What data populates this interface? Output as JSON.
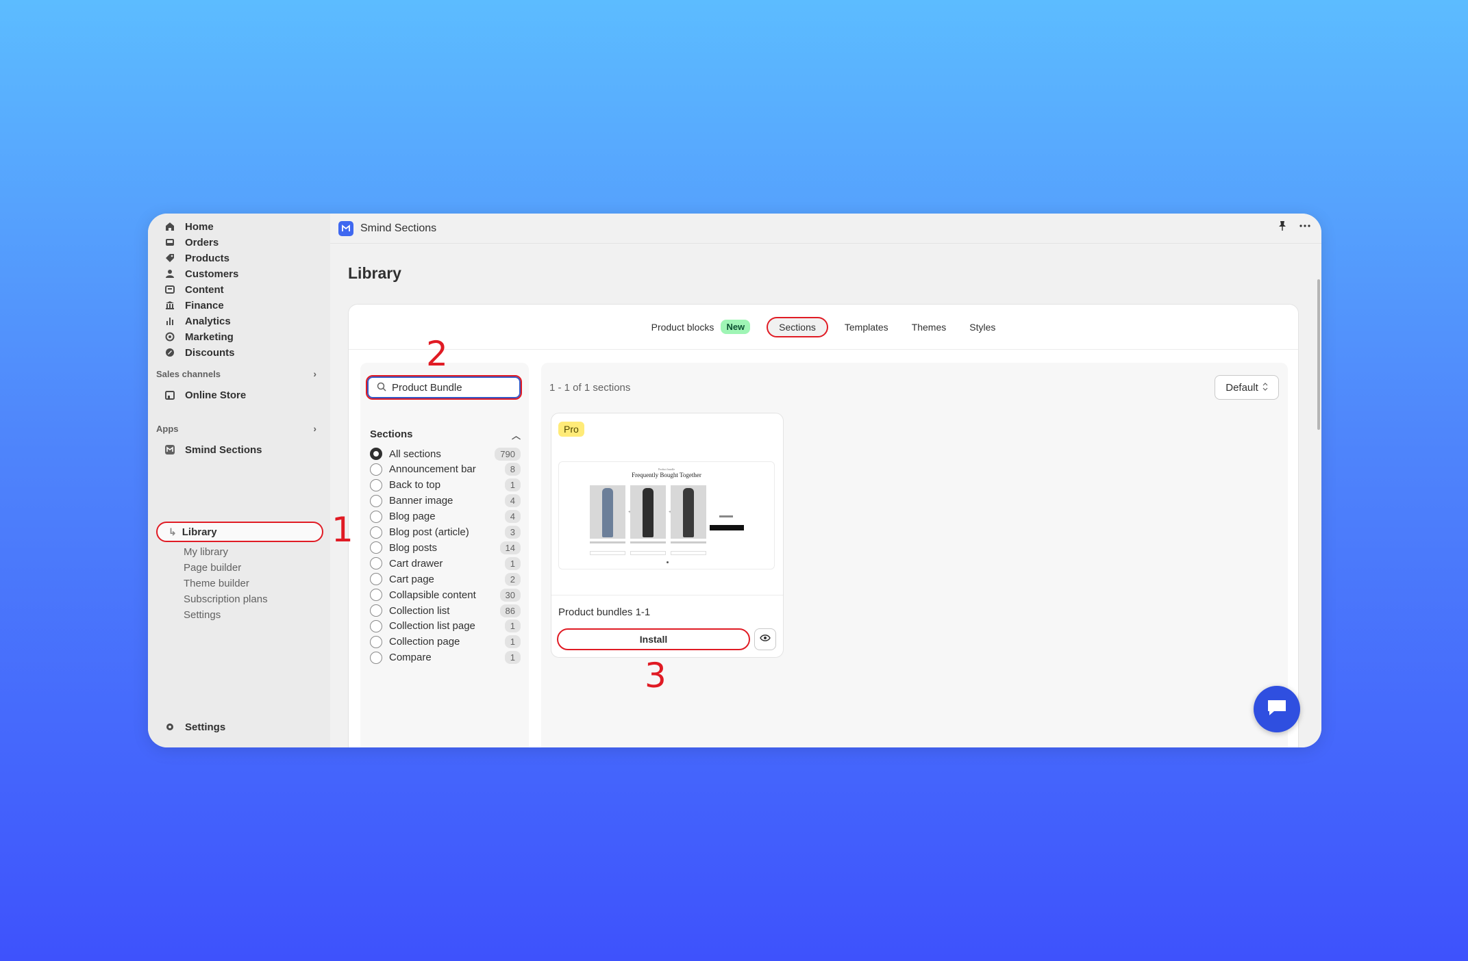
{
  "sidebar": {
    "nav": [
      {
        "label": "Home",
        "icon": "home-icon"
      },
      {
        "label": "Orders",
        "icon": "inbox-icon"
      },
      {
        "label": "Products",
        "icon": "tag-icon"
      },
      {
        "label": "Customers",
        "icon": "person-icon"
      },
      {
        "label": "Content",
        "icon": "content-icon"
      },
      {
        "label": "Finance",
        "icon": "bank-icon"
      },
      {
        "label": "Analytics",
        "icon": "bar-chart-icon"
      },
      {
        "label": "Marketing",
        "icon": "target-icon"
      },
      {
        "label": "Discounts",
        "icon": "discount-icon"
      }
    ],
    "sales_channels_label": "Sales channels",
    "online_store_label": "Online Store",
    "apps_label": "Apps",
    "app_name": "Smind Sections",
    "library_label": "Library",
    "sub_items": [
      "My library",
      "Page builder",
      "Theme builder",
      "Subscription plans",
      "Settings"
    ],
    "settings_label": "Settings"
  },
  "topbar": {
    "app_name": "Smind Sections"
  },
  "page": {
    "title": "Library"
  },
  "tabs": {
    "product_blocks": "Product blocks",
    "new_badge": "New",
    "sections": "Sections",
    "templates": "Templates",
    "themes": "Themes",
    "styles": "Styles"
  },
  "search": {
    "value": "Product Bundle"
  },
  "filters": {
    "heading": "Sections",
    "items": [
      {
        "label": "All sections",
        "count": "790",
        "selected": true
      },
      {
        "label": "Announcement bar",
        "count": "8"
      },
      {
        "label": "Back to top",
        "count": "1"
      },
      {
        "label": "Banner image",
        "count": "4"
      },
      {
        "label": "Blog page",
        "count": "4"
      },
      {
        "label": "Blog post (article)",
        "count": "3"
      },
      {
        "label": "Blog posts",
        "count": "14"
      },
      {
        "label": "Cart drawer",
        "count": "1"
      },
      {
        "label": "Cart page",
        "count": "2"
      },
      {
        "label": "Collapsible content",
        "count": "30"
      },
      {
        "label": "Collection list",
        "count": "86"
      },
      {
        "label": "Collection list page",
        "count": "1"
      },
      {
        "label": "Collection page",
        "count": "1"
      },
      {
        "label": "Compare",
        "count": "1"
      }
    ]
  },
  "results": {
    "count_text": "1 - 1 of 1 sections",
    "sort_label": "Default",
    "item": {
      "badge": "Pro",
      "preview_kicker": "Product bundle",
      "preview_title": "Frequently Bought Together",
      "name": "Product bundles 1-1",
      "install_label": "Install"
    }
  },
  "annotations": [
    "1",
    "2",
    "3"
  ],
  "colors": {
    "accent_red": "#e01b24",
    "brand_blue": "#2f4fe0",
    "new_badge": "#9ff5b5",
    "pro_badge": "#ffeb78"
  }
}
